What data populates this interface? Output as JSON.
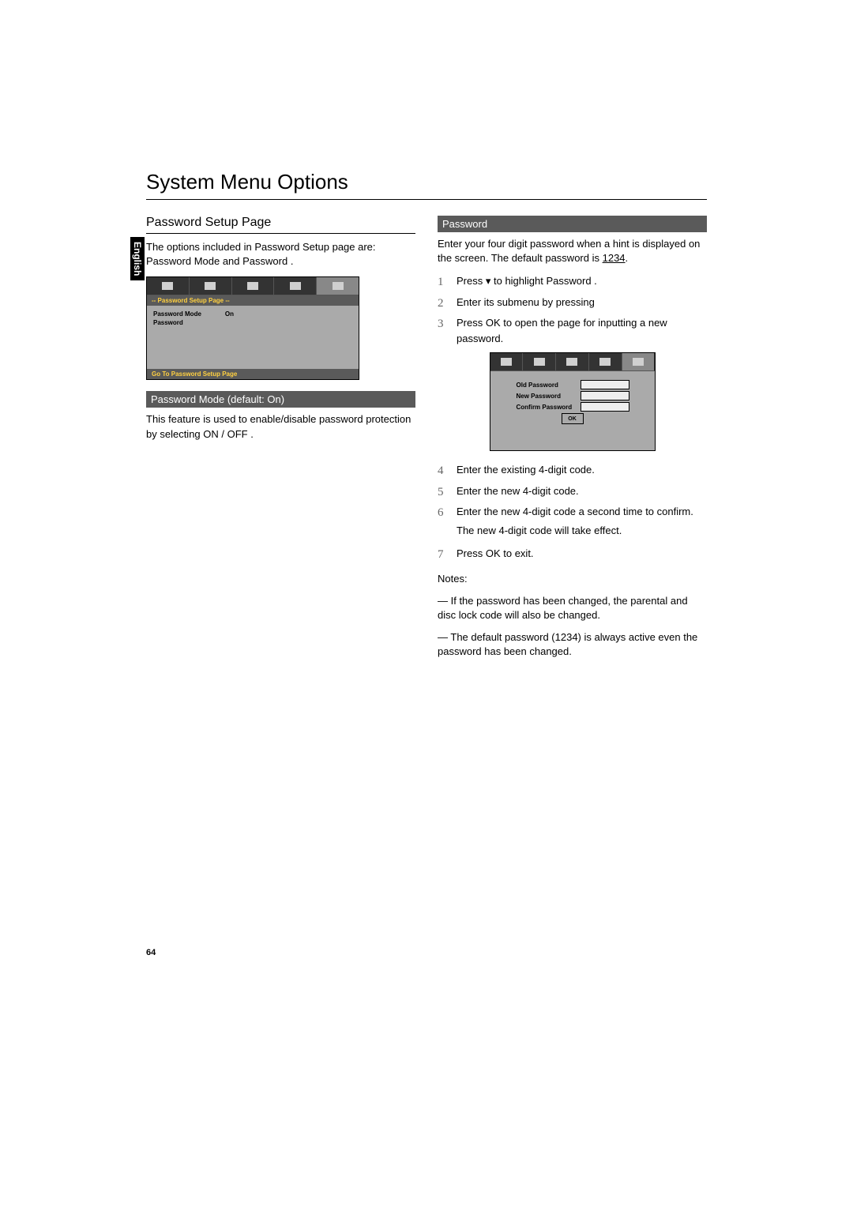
{
  "sideTab": "English",
  "title": "System Menu Options",
  "left": {
    "heading": "Password Setup Page",
    "intro": "The options included in Password Setup page are: Password Mode and Password .",
    "osd": {
      "title": "-- Password Setup Page --",
      "row1_label": "Password Mode",
      "row1_value": "On",
      "row2_label": "Password",
      "footer": "Go To Password Setup Page"
    },
    "sub": "Password Mode (default: On)",
    "subText": "This feature is used to enable/disable password protection by selecting ON / OFF ."
  },
  "right": {
    "sub": "Password",
    "intro1": "Enter your four digit password when a hint is displayed on the screen. The default password is ",
    "defaultPw": "1234",
    "steps": {
      "s1a": "Press ",
      "s1b": " to highlight Password .",
      "s2": "Enter its submenu by pressing",
      "s3a": "Press ",
      "s3b": "OK",
      "s3c": " to open the page for inputting a new password.",
      "s4": "Enter the existing 4-digit code.",
      "s5": "Enter the new 4-digit code.",
      "s6": "Enter the new 4-digit code a second time to confirm.",
      "s6b": "The new 4-digit code will take effect.",
      "s7a": "Press ",
      "s7b": "OK",
      "s7c": " to exit."
    },
    "osd2": {
      "old": "Old Password",
      "new": "New Password",
      "confirm": "Confirm Password",
      "ok": "OK"
    },
    "notesLabel": "Notes:",
    "note1": "— If the password has been changed, the parental and disc lock code will also be changed.",
    "note2a": "— The default password (",
    "note2pw": "1234",
    "note2b": ") is always active even the password has been changed."
  },
  "pageNumber": "64"
}
